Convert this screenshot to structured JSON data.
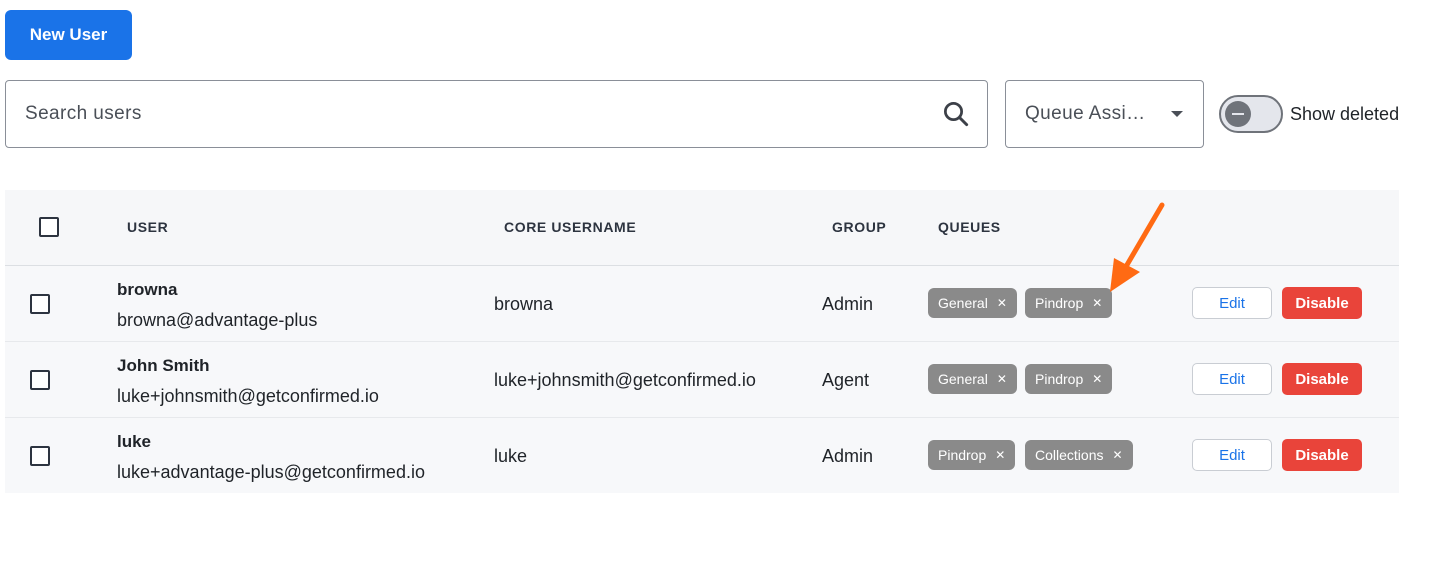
{
  "toolbar": {
    "new_user_label": "New User"
  },
  "search": {
    "placeholder": "Search users"
  },
  "queue_filter": {
    "label": "Queue Assi…"
  },
  "show_deleted": {
    "label": "Show deleted",
    "checked": false
  },
  "table": {
    "headers": {
      "user": "USER",
      "core_username": "CORE USERNAME",
      "group": "GROUP",
      "queues": "QUEUES"
    },
    "rows": [
      {
        "name": "browna",
        "email": "browna@advantage-plus",
        "core_username": "browna",
        "group": "Admin",
        "queues": [
          "General",
          "Pindrop"
        ],
        "edit_label": "Edit",
        "disable_label": "Disable"
      },
      {
        "name": "John Smith",
        "email": "luke+johnsmith@getconfirmed.io",
        "core_username": "luke+johnsmith@getconfirmed.io",
        "group": "Agent",
        "queues": [
          "General",
          "Pindrop"
        ],
        "edit_label": "Edit",
        "disable_label": "Disable"
      },
      {
        "name": "luke",
        "email": "luke+advantage-plus@getconfirmed.io",
        "core_username": "luke",
        "group": "Admin",
        "queues": [
          "Pindrop",
          "Collections"
        ],
        "edit_label": "Edit",
        "disable_label": "Disable"
      }
    ]
  },
  "colors": {
    "primary": "#1a73e8",
    "danger": "#e9443a",
    "chip": "#8a8a8a",
    "annotation_arrow": "#ff6a13"
  }
}
